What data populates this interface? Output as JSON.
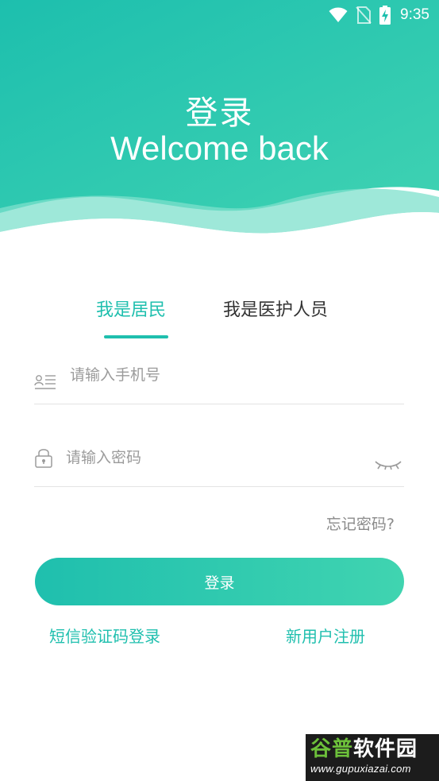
{
  "status_bar": {
    "time": "9:35",
    "icons": [
      "wifi-icon",
      "no-sim-icon",
      "battery-charging-icon"
    ]
  },
  "header": {
    "title": "登录",
    "subtitle": "Welcome back"
  },
  "tabs": [
    {
      "label": "我是居民",
      "active": true
    },
    {
      "label": "我是医护人员",
      "active": false
    }
  ],
  "form": {
    "phone_placeholder": "请输入手机号",
    "phone_value": "",
    "password_placeholder": "请输入密码",
    "password_value": "",
    "forgot_label": "忘记密码?",
    "login_label": "登录"
  },
  "links": {
    "sms_login": "短信验证码登录",
    "register": "新用户注册"
  },
  "watermark": {
    "brand_part1": "谷普",
    "brand_part2": "软件园",
    "url": "www.gupuxiazai.com"
  },
  "colors": {
    "accent": "#1fbfae",
    "accent_light": "#40d4b0",
    "text_dark": "#333333",
    "text_muted": "#9b9b9b"
  }
}
